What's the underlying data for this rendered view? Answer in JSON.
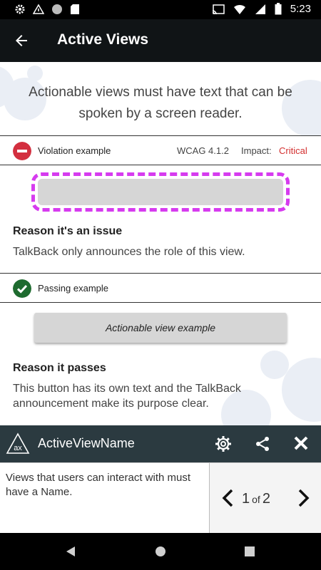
{
  "status_bar": {
    "time": "5:23",
    "left_icons": [
      "gear-icon",
      "signal-triangle-icon",
      "circle-icon",
      "sd-card-icon"
    ],
    "right_icons": [
      "cast-icon",
      "wifi-icon",
      "cell-signal-icon",
      "battery-icon"
    ]
  },
  "app_bar": {
    "title": "Active Views",
    "back_icon": "arrow-back-icon"
  },
  "intro": "Actionable views must have text that can be spoken by a screen reader.",
  "violation": {
    "label": "Violation example",
    "wcag": "WCAG 4.1.2",
    "impact_label": "Impact:",
    "impact_value": "Critical",
    "colors": {
      "icon": "#d32f3f",
      "impact": "#d32f2f",
      "dashed_border": "#d63bef"
    }
  },
  "reason_issue": {
    "heading": "Reason it's an issue",
    "text": "TalkBack only announces the role of this view."
  },
  "passing": {
    "label": "Passing example",
    "button_label": "Actionable view example",
    "colors": {
      "icon": "#1e6b2f"
    }
  },
  "reason_passes": {
    "heading": "Reason it passes",
    "text": "This button has its own text and the TalkBack announcement make its purpose clear."
  },
  "panel": {
    "name": "ActiveViewName",
    "logo_text": "ax",
    "description": "Views that users can interact with must have a Name.",
    "page_current": "1",
    "page_of": "of",
    "page_total": "2",
    "background": "#2b3a40"
  },
  "nav_bar": {
    "icons": [
      "back-triangle-icon",
      "home-circle-icon",
      "recents-square-icon"
    ]
  }
}
